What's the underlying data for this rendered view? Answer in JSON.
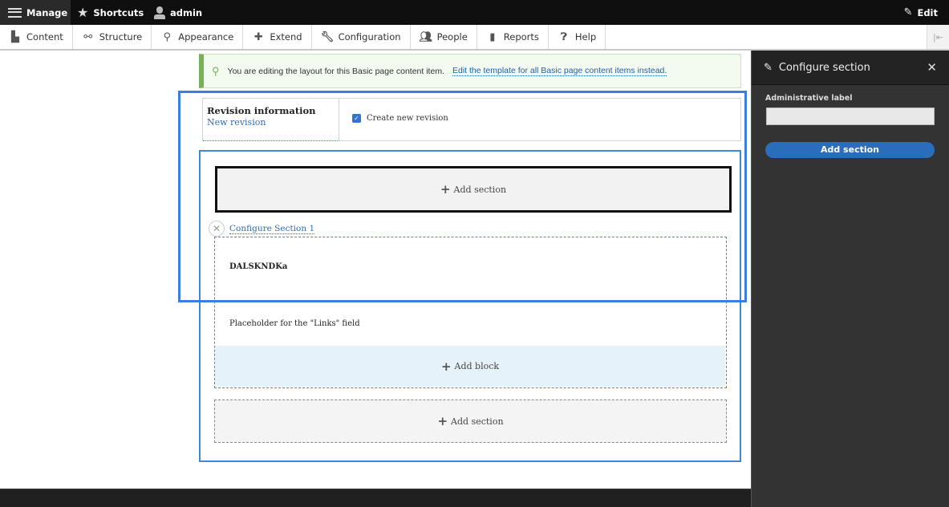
{
  "toolbar": {
    "manage": "Manage",
    "shortcuts": "Shortcuts",
    "user": "admin",
    "edit": "Edit"
  },
  "tray": {
    "items": [
      {
        "label": "Content",
        "icon": "file-icon"
      },
      {
        "label": "Structure",
        "icon": "sitemap-icon"
      },
      {
        "label": "Appearance",
        "icon": "paintbrush-icon"
      },
      {
        "label": "Extend",
        "icon": "puzzle-icon"
      },
      {
        "label": "Configuration",
        "icon": "wrench-icon"
      },
      {
        "label": "People",
        "icon": "people-icon"
      },
      {
        "label": "Reports",
        "icon": "bar-chart-icon"
      },
      {
        "label": "Help",
        "icon": "help-icon"
      }
    ]
  },
  "message": {
    "text": "You are editing the layout for this Basic page content item.",
    "link": "Edit the template for all Basic page content items instead."
  },
  "revision": {
    "title": "Revision information",
    "summary": "New revision",
    "checkbox_label": "Create new revision",
    "checked": true
  },
  "layout": {
    "add_section_top": "Add section",
    "configure_section": "Configure Section 1",
    "blocks": [
      "DALSKNDKa",
      "Placeholder for the \"Links\" field"
    ],
    "add_block": "Add block",
    "add_section_bottom": "Add section"
  },
  "sidebar": {
    "title": "Configure section",
    "field_label": "Administrative label",
    "field_value": "",
    "submit": "Add section"
  },
  "colors": {
    "accent_blue": "#3a7ee0",
    "status_green": "#77b259",
    "button_blue": "#2a6ebb"
  }
}
